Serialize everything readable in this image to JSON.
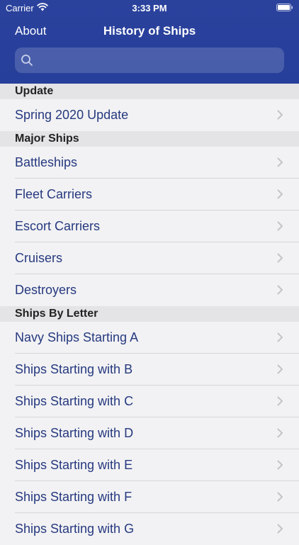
{
  "status_bar": {
    "carrier": "Carrier",
    "time": "3:33 PM"
  },
  "nav": {
    "about_label": "About",
    "title": "History of Ships"
  },
  "search": {
    "placeholder": ""
  },
  "sections": [
    {
      "header": "Update",
      "items": [
        "Spring 2020 Update"
      ]
    },
    {
      "header": "Major Ships",
      "items": [
        "Battleships",
        "Fleet Carriers",
        "Escort Carriers",
        "Cruisers",
        "Destroyers"
      ]
    },
    {
      "header": "Ships By Letter",
      "items": [
        "Navy Ships Starting A",
        "Ships Starting with B",
        "Ships Starting with C",
        "Ships Starting with D",
        "Ships Starting with E",
        "Ships Starting with F",
        "Ships Starting with G"
      ]
    }
  ],
  "colors": {
    "nav_bg": "#2b429d",
    "link_text": "#26397f",
    "section_bg": "#e4e4e6",
    "list_bg": "#f2f2f4"
  }
}
